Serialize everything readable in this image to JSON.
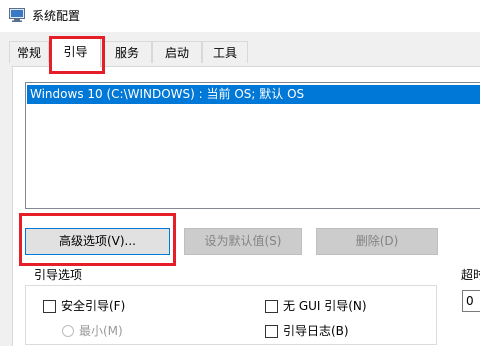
{
  "window": {
    "title": "系统配置",
    "icon": "msconfig-icon"
  },
  "tabs": [
    {
      "label": "常规",
      "selected": false
    },
    {
      "label": "引导",
      "selected": true
    },
    {
      "label": "服务",
      "selected": false
    },
    {
      "label": "启动",
      "selected": false
    },
    {
      "label": "工具",
      "selected": false
    }
  ],
  "boot_list": {
    "items": [
      {
        "label": "Windows 10 (C:\\WINDOWS) : 当前 OS; 默认 OS",
        "selected": true
      }
    ]
  },
  "buttons": {
    "advanced": {
      "label": "高级选项(V)...",
      "enabled": true,
      "highlighted": true
    },
    "set_default": {
      "label": "设为默认值(S)",
      "enabled": false
    },
    "delete": {
      "label": "删除(D)",
      "enabled": false
    }
  },
  "boot_options": {
    "group_label": "引导选项",
    "safe_boot": {
      "label": "安全引导(F)",
      "checked": false
    },
    "minimal": {
      "label": "最小(M)",
      "checked": false,
      "enabled": false
    },
    "no_gui_boot": {
      "label": "无 GUI 引导(N)",
      "checked": false
    },
    "boot_log": {
      "label": "引导日志(B)",
      "checked": false
    }
  },
  "timeout": {
    "label": "超时",
    "value": "0"
  },
  "annotations": {
    "highlight_color": "#e51e28",
    "highlighted_items": [
      "tab-boot",
      "advanced-options-button"
    ]
  },
  "colors": {
    "selection": "#0078d7",
    "window_bg": "#f0f0f0",
    "panel_bg": "#ffffff"
  }
}
